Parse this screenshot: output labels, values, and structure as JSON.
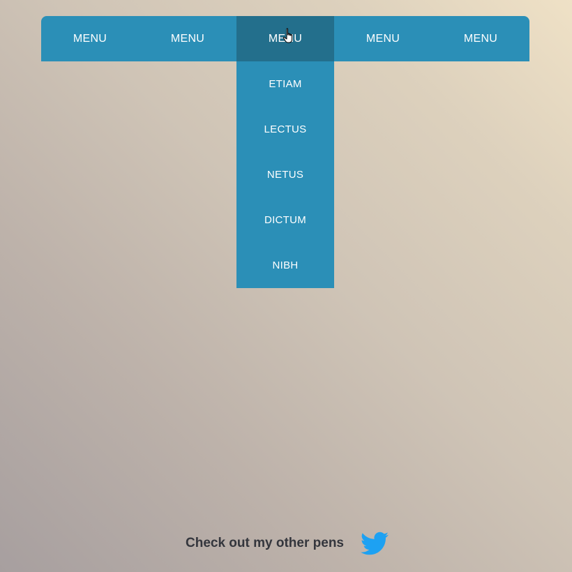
{
  "nav": {
    "items": [
      {
        "label": "MENU"
      },
      {
        "label": "MENU"
      },
      {
        "label": "MENU"
      },
      {
        "label": "MENU"
      },
      {
        "label": "MENU"
      }
    ],
    "active_index": 2
  },
  "dropdown": {
    "items": [
      {
        "label": "ETIAM"
      },
      {
        "label": "LECTUS"
      },
      {
        "label": "NETUS"
      },
      {
        "label": "DICTUM"
      },
      {
        "label": "NIBH"
      }
    ]
  },
  "footer": {
    "text": "Check out my other pens",
    "icon": "twitter-icon"
  },
  "colors": {
    "nav_background": "#2b8fb7",
    "nav_active": "#236f8c",
    "text": "#ffffff",
    "footer_text": "#34363d",
    "twitter_blue": "#1da1f2"
  }
}
